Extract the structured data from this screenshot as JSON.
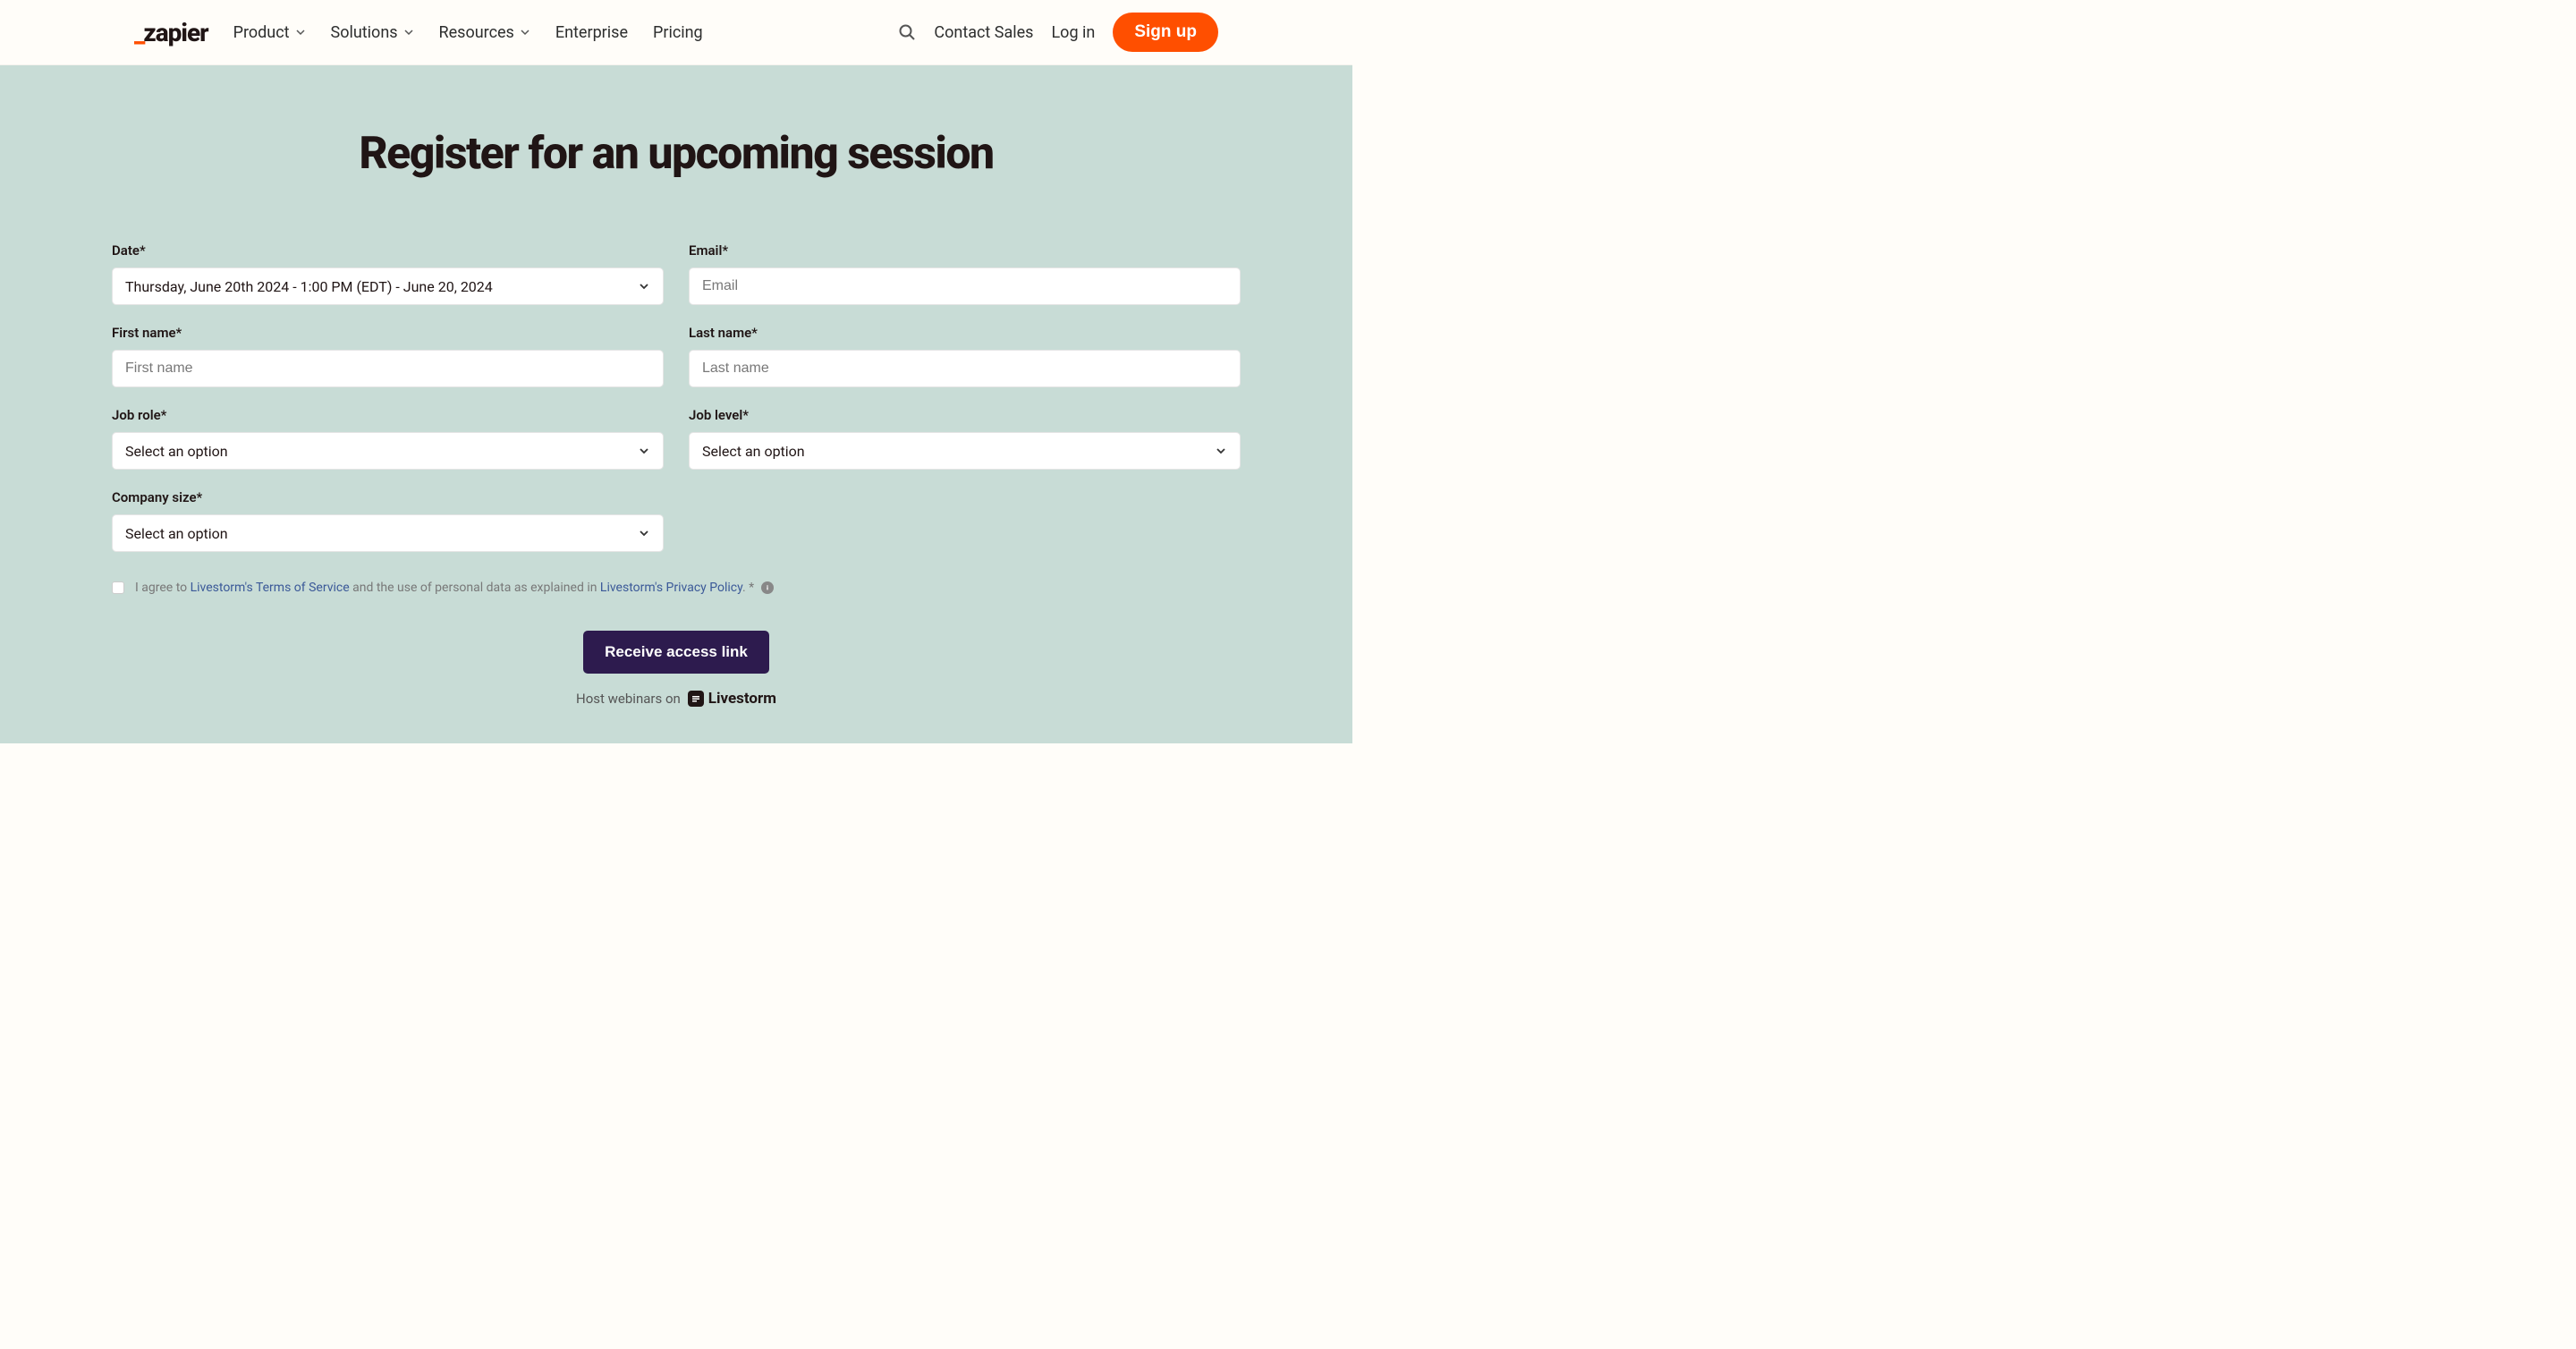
{
  "header": {
    "logo_text": "zapier",
    "nav": {
      "product": "Product",
      "solutions": "Solutions",
      "resources": "Resources",
      "enterprise": "Enterprise",
      "pricing": "Pricing"
    },
    "contact": "Contact Sales",
    "login": "Log in",
    "signup": "Sign up"
  },
  "main": {
    "title": "Register for an upcoming session",
    "form": {
      "date": {
        "label": "Date*",
        "value": "Thursday, June 20th 2024 - 1:00 PM (EDT) - June 20, 2024"
      },
      "email": {
        "label": "Email*",
        "placeholder": "Email"
      },
      "first_name": {
        "label": "First name*",
        "placeholder": "First name"
      },
      "last_name": {
        "label": "Last name*",
        "placeholder": "Last name"
      },
      "job_role": {
        "label": "Job role*",
        "placeholder": "Select an option"
      },
      "job_level": {
        "label": "Job level*",
        "placeholder": "Select an option"
      },
      "company_size": {
        "label": "Company size*",
        "placeholder": "Select an option"
      }
    },
    "terms": {
      "prefix": "I agree to ",
      "link1": "Livestorm's Terms of Service",
      "middle": " and the use of personal data as explained in ",
      "link2": "Livestorm's Privacy Policy",
      "suffix": ". * "
    },
    "submit": "Receive access link",
    "footer": {
      "text": "Host webinars on",
      "brand": "Livestorm"
    }
  }
}
